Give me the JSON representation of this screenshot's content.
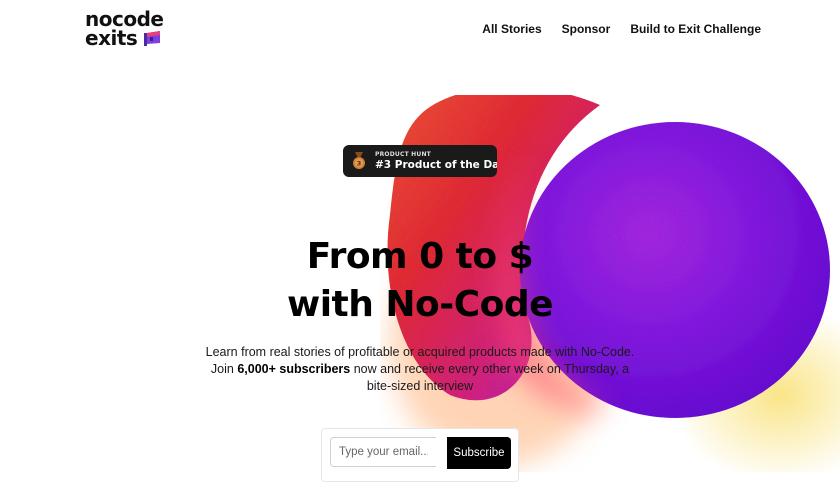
{
  "brand": {
    "line1": "nocode",
    "line2": "exits",
    "icon": "flag-icon"
  },
  "nav": {
    "items": [
      {
        "label": "All Stories"
      },
      {
        "label": "Sponsor"
      },
      {
        "label": "Build to Exit Challenge"
      }
    ]
  },
  "badge": {
    "kicker": "PRODUCT HUNT",
    "title": "#3 Product of the Day",
    "medal_number": "3",
    "icon": "medal-icon"
  },
  "hero": {
    "title_line1": "From 0 to $",
    "title_line2": "with No-Code",
    "sub_before": "Learn from real stories of profitable or acquired products made with No-Code. Join ",
    "sub_bold": "6,000+ subscribers",
    "sub_after": " now and receive every other week on Thursday, a bite-sized interview"
  },
  "signup": {
    "placeholder": "Type your email...",
    "button": "Subscribe"
  },
  "colors": {
    "blob_red": "#f0282e",
    "blob_purple": "#8a1ef0",
    "blob_yellow": "#f6d64a",
    "button_bg": "#000000"
  }
}
